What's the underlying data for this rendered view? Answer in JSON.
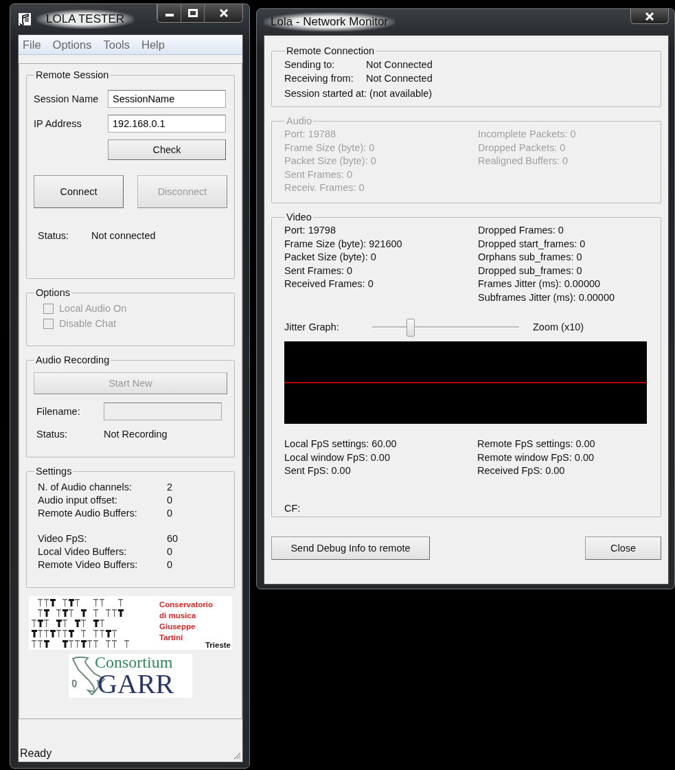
{
  "tester": {
    "title": "LOLA TESTER",
    "menu": [
      "File",
      "Options",
      "Tools",
      "Help"
    ],
    "remote_session": {
      "title": "Remote Session",
      "fields": [
        {
          "label": "Session Name",
          "value": "SessionName"
        },
        {
          "label": "IP Address",
          "value": "192.168.0.1"
        }
      ],
      "check_button": "Check",
      "buttons": [
        {
          "label": "Connect",
          "disabled": false
        },
        {
          "label": "Disconnect",
          "disabled": true
        }
      ],
      "status_label": "Status:",
      "status": "Not connected"
    },
    "options": {
      "title": "Options",
      "checkboxes": [
        {
          "label": "Local Audio On",
          "checked": false,
          "disabled": true
        },
        {
          "label": "Disable Chat",
          "checked": false,
          "disabled": true
        }
      ]
    },
    "audio_recording": {
      "title": "Audio Recording",
      "button": {
        "label": "Start New",
        "disabled": true
      },
      "filename_label": "Filename:",
      "filename": {
        "disabled": true
      },
      "status_label": "Status:",
      "status": "Not Recording"
    },
    "settings": {
      "title": "Settings",
      "groups": [
        [
          {
            "label": "N. of Audio channels:",
            "value": "2"
          },
          {
            "label": "Audio input offset:",
            "value": "0"
          },
          {
            "label": "Remote Audio Buffers:",
            "value": "0"
          }
        ],
        [
          {
            "label": "Video FpS:",
            "value": "60"
          },
          {
            "label": "Local Video Buffers:",
            "value": "0"
          },
          {
            "label": "Remote Video Buffers:",
            "value": "0"
          }
        ]
      ]
    },
    "logos": {
      "conservatorio": {
        "lines": [
          "Conservatorio",
          "di musica",
          "Giuseppe",
          "Tartini"
        ],
        "city": "Trieste"
      },
      "garr": {
        "top": "Consortium",
        "bottom": "GARR"
      }
    },
    "status_bar": "Ready"
  },
  "monitor": {
    "title": "Lola - Network Monitor",
    "remote_connection": {
      "title": "Remote Connection",
      "rows": [
        {
          "label": "Sending to:",
          "value": "Not Connected"
        },
        {
          "label": "Receiving from:",
          "value": "Not Connected"
        }
      ],
      "session": "Session started at: (not available)"
    },
    "audio": {
      "title": "Audio",
      "disabled": true,
      "left": [
        "Port: 19788",
        "Frame Size (byte): 0",
        "Packet Size (byte): 0",
        "Sent Frames: 0",
        "Receiv. Frames: 0"
      ],
      "right": [
        "Incomplete Packets: 0",
        "Dropped Packets: 0",
        "Realigned Buffers: 0"
      ]
    },
    "video": {
      "title": "Video",
      "disabled": false,
      "left": [
        "Port: 19798",
        "Frame Size (byte): 921600",
        "Packet Size (byte): 0",
        "Sent Frames: 0",
        "Received Frames: 0"
      ],
      "right": [
        "Dropped Frames: 0",
        "Dropped start_frames: 0",
        "Orphans sub_frames: 0",
        "Dropped sub_frames: 0",
        "Frames Jitter (ms): 0.00000",
        "Subframes Jitter (ms): 0.00000"
      ],
      "slider": {
        "label": "Jitter Graph:",
        "level": 0.26,
        "reading": "Zoom (x10)"
      },
      "fps_left": [
        "Local FpS settings: 60.00",
        "Local window FpS: 0.00",
        "Sent FpS: 0.00"
      ],
      "fps_right": [
        "Remote FpS settings: 0.00",
        "Remote window FpS: 0.00",
        "Received FpS: 0.00"
      ],
      "cf": "CF:"
    },
    "buttons": [
      "Send Debug Info to remote",
      "Close"
    ]
  }
}
